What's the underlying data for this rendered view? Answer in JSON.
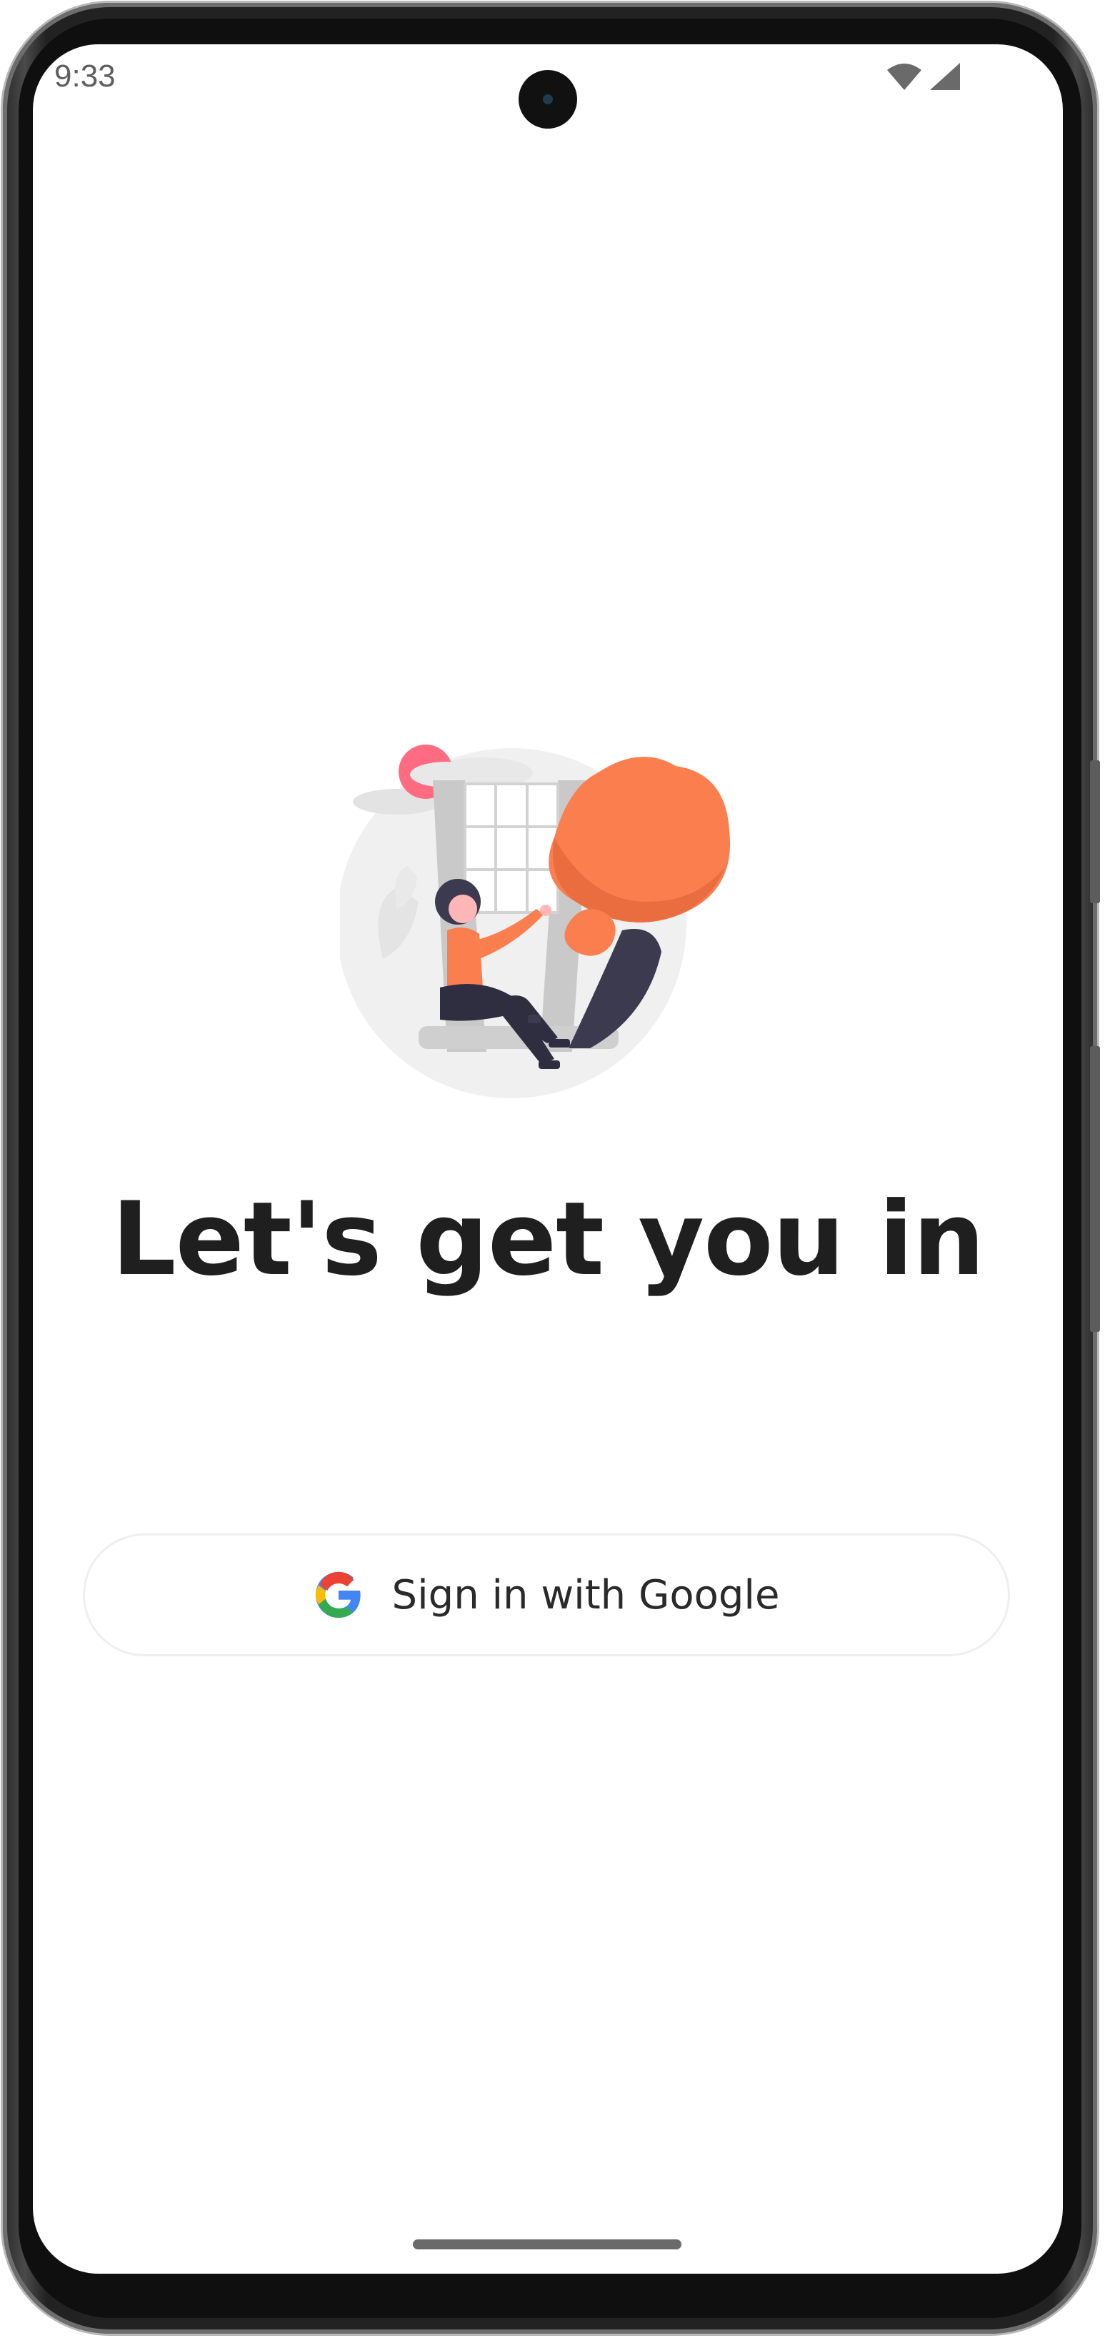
{
  "status_bar": {
    "time": "9:33",
    "wifi_icon": "wifi-icon",
    "signal_icon": "signal-icon"
  },
  "illustration": {
    "icon": "person-sitting-by-window-illustration",
    "colors": {
      "accent": "#fb7e4f",
      "pink": "#ff6b81",
      "dark": "#3b3a4e",
      "light_gray": "#f0f0f0"
    }
  },
  "main": {
    "headline": "Let's get you in",
    "google_button": {
      "label": "Sign in with Google",
      "icon": "google-logo-icon"
    }
  }
}
